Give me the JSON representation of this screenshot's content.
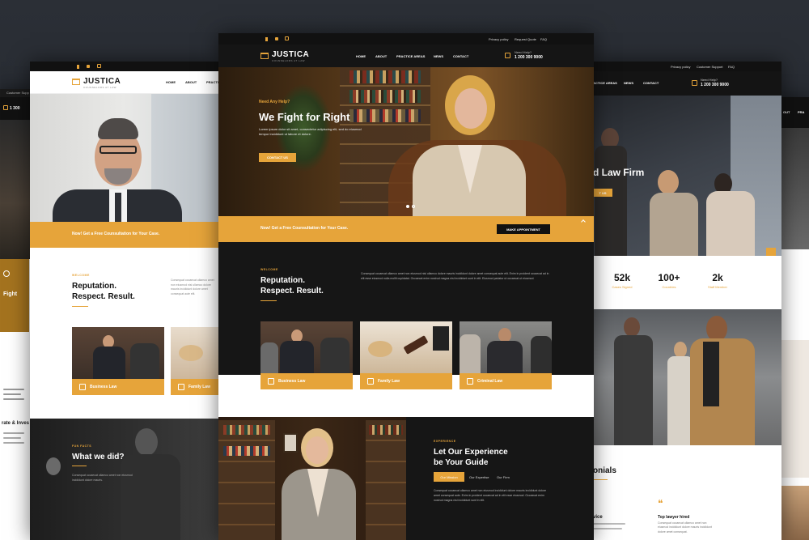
{
  "brand": {
    "name": "JUSTICA",
    "tagline": "COUNSELORS AT LAW"
  },
  "colors": {
    "accent": "#e6a43a",
    "dark": "#161616",
    "light": "#ffffff"
  },
  "social": [
    "facebook-icon",
    "twitter-icon",
    "instagram-icon"
  ],
  "main": {
    "topbar": {
      "links": [
        "Privacy policy",
        "Request Quote",
        "FAQ"
      ]
    },
    "nav": [
      "HOME",
      "ABOUT",
      "PRACTICE AREAS",
      "NEWS",
      "CONTACT"
    ],
    "phone": {
      "label": "Need Help?",
      "number": "1 200 300 9000"
    },
    "hero": {
      "kicker": "Need Any Help?",
      "title": "We Fight for Right",
      "body": "Lorem ipsum dolor sit amet, consectetur adipiscing elit, sed do eiusmod tempor incididunt ut labore et dolore.",
      "button": "CONTACT US"
    },
    "banner": {
      "text": "Now! Get a Free Counsultation for Your Case.",
      "button": "MAKE APPOINTMENT"
    },
    "about": {
      "kicker": "WELCOME",
      "title_line1": "Reputation.",
      "title_line2": "Respect. Result.",
      "body": "Consequat occaecat ullamco amet non eiusmod nisi ullamco dolore mauris incididunt dolore amet consequat aute elit. Enim in proident occaecat ad in elit esse eiusmod nulla mollit cupidatat. Occaecat enim nostrud magna nisi incididunt sunt in elit. Eiusmod pariatur ut occaecat ut eiusmod."
    },
    "cards": [
      "Business Law",
      "Family Law",
      "Criminal Law"
    ],
    "experience": {
      "kicker": "EXPERIENCE",
      "title_line1": "Let Our Experience",
      "title_line2": "be Your Guide",
      "tabs": [
        "Our Mission",
        "Our Expertise",
        "Our Firm"
      ],
      "body": "Consequat occaecat ullamco amet non eiusmod incididunt dolore mauris incididunt dolore amet consequat aute. Enim in proident occaecat ad in elit esse eiusmod. Occaecat enim nostrud magna nisi incididunt sunt in elit."
    }
  },
  "left": {
    "nav": [
      "HOME",
      "ABOUT",
      "PRACTI"
    ],
    "banner": "Now! Get a Free Counsultation for Your Case.",
    "about": {
      "kicker": "WELCOME",
      "title_line1": "Reputation.",
      "title_line2": "Respect. Result.",
      "body": "Consequat occaecat ullamco amet non eiusmod nisi ullamco dolore mauris incididunt dolore amet consequat aute elit."
    },
    "cards": [
      "Business Law",
      "Family Law"
    ],
    "fun": {
      "kicker": "FUN FACTS",
      "title": "What we did?",
      "body": "Consequat occaecat ullamco amet non eiusmod incididunt dolore mauris."
    }
  },
  "farleft": {
    "topbar": "Customer Supp",
    "phone": "1 300",
    "fight": "Fight",
    "fragment": "rate & Inves"
  },
  "right": {
    "topbar": [
      "Privacy policy",
      "Customer Support",
      "FAQ"
    ],
    "nav": [
      "ACTICE AREAS",
      "NEWS",
      "CONTACT"
    ],
    "phone": {
      "label": "Need Help?",
      "number": "1 200 300 9000"
    },
    "hero_fragment": "d Law Firm",
    "btn_fragment": "T US",
    "stats": [
      {
        "value": "52k",
        "label": "Cases Signed"
      },
      {
        "value": "100+",
        "label": "Countries"
      },
      {
        "value": "2k",
        "label": "Staff Member"
      }
    ],
    "testimonials_fragment": "onials",
    "testimonial_left": "vice",
    "testimonial_title": "Top lawyer hired",
    "testimonial_body": "Consequat occaecat ullamco amet non eiusmod incididunt dolore mauris incididunt dolore amet consequat.",
    "quote_glyph": "❝"
  },
  "farright": {
    "nav_fragment": "OUT",
    "nav2_fragment": "PRA"
  }
}
